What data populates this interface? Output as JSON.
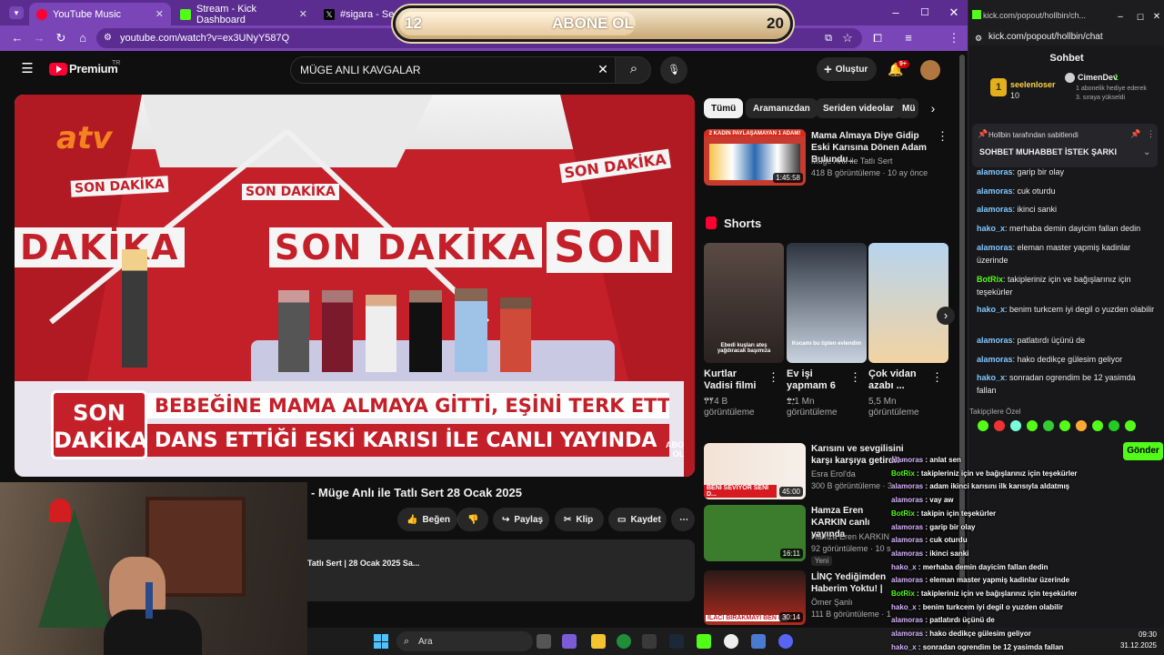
{
  "tabs": [
    {
      "title": "YouTube Music",
      "color": "#ff0033"
    },
    {
      "title": "Stream - Kick Dashboard",
      "color": "#53fc18"
    },
    {
      "title": "#sigara - Search / X",
      "color": "#000000"
    }
  ],
  "address": "youtube.com/watch?v=ex3UNyY587Q",
  "yt": {
    "logo": "Premium",
    "region": "TR",
    "search": "MÜGE ANLI KAVGALAR",
    "create": "Oluştur",
    "notif": "9+"
  },
  "video": {
    "channel_logo": "atv",
    "wall1": "SON DAKİKA",
    "wall2": "DAKİKA",
    "wall3": "SON DAKİKA",
    "wall4": "SON",
    "banner_label1": "SON",
    "banner_label2": "DAKİKA",
    "line1": "BEBEĞİNE MAMA ALMAYA GİTTİ, EŞİNİ TERK ETTİ",
    "line2": "DANS ETTİĞİ ESKİ KARISI İLE CANLI YAYINDA",
    "corner": "ABONE OL"
  },
  "video_title": "- Müge Anlı ile Tatlı Sert 28 Ocak 2025",
  "actions": {
    "like": "Beğen",
    "share": "Paylaş",
    "clip": "Klip",
    "save": "Kaydet"
  },
  "desc_snippet": "Tatlı Sert | 28 Ocak 2025 Sa...",
  "chips": [
    "Tümü",
    "Aramanızdan",
    "Seriden videolar",
    "Mü"
  ],
  "related_top": {
    "title": "Mama Almaya Diye Gidip Eski Karısına Dönen Adam Bulundu...",
    "channel": "Müge Anlı ile Tatlı Sert",
    "meta": "418 B görüntüleme · 10 ay önce",
    "duration": "1:45:58",
    "thumb_text": "2 KADIN PAYLAŞAMAYAN 1 ADAM!"
  },
  "shorts": {
    "heading": "Shorts",
    "items": [
      {
        "title": "Kurtlar Vadisi filmi ...",
        "views": "774 B görüntüleme",
        "thumb_text": "Ebedi kuşları ateş yağdıracak başımıza"
      },
      {
        "title": "Ev işi yapmam 6 ...",
        "views": "1,1 Mn görüntüleme",
        "thumb_text": "Kocamı bu tipten evlendim"
      },
      {
        "title": "Çok vidan azabı ...",
        "views": "5,5 Mn görüntüleme",
        "thumb_text": ""
      }
    ]
  },
  "related": [
    {
      "title": "Karısını ve sevgilisini karşı karşıya getirdi! - Esra...",
      "channel": "Esra Erol'da",
      "meta": "300 B görüntüleme · 3 a...",
      "duration": "45:00",
      "thumb_text": "BENİ SEVİYOR SENİ D..."
    },
    {
      "title": "Hamza Eren KARKIN canlı yayında",
      "channel": "Hamza Eren KARKIN",
      "meta": "92 görüntüleme · 10 saat önce yayınlandı",
      "duration": "16:11",
      "badge": "Yeni"
    },
    {
      "title": "LİNÇ Yediğimden Haberim Yoktu! | Ömer'le Anlar... @Okakal",
      "channel": "Ömer Şanlı",
      "meta": "111 B görüntüleme · 16 saat önce",
      "duration": "30:14",
      "badge": "Yeni",
      "thumb_text": "İLACI BIRAKMAYI BEN İS"
    }
  ],
  "kick": {
    "tab_url": "kick.com/popout/hollbin/ch...",
    "url": "kick.com/popout/hollbin/chat",
    "title": "Sohbet",
    "top1": {
      "name": "seelenloser",
      "count": "10"
    },
    "top2": {
      "name": "CimenDev",
      "count": "1",
      "desc": "1 abonelik hediye ederek 3. sıraya yükseldi"
    },
    "pinned_by": "Hollbin tarafından sabitlendi",
    "pinned_text": "SOHBET MUHABBET İSTEK ŞARKI",
    "messages": [
      {
        "user": "alamoras",
        "text": "garip bir olay",
        "bot": false
      },
      {
        "user": "alamoras",
        "text": "cuk oturdu",
        "bot": false
      },
      {
        "user": "alamoras",
        "text": "ikinci sanki",
        "bot": false
      },
      {
        "user": "hako_x",
        "text": "merhaba demin dayicim fallan dedin",
        "bot": false
      },
      {
        "user": "alamoras",
        "text": "eleman master yapmiş kadinlar üzerinde",
        "bot": false
      },
      {
        "user": "BotRix",
        "text": "takipleriniz için ve bağışlarınız için teşekürler",
        "bot": true
      },
      {
        "user": "hako_x",
        "text": "benim turkcem iyi degil o yuzden olabilir",
        "bot": false
      },
      {
        "user": "alamoras",
        "text": "patlatırdı üçünü de",
        "bot": false
      },
      {
        "user": "alamoras",
        "text": "hako dedikçe gülesim geliyor",
        "bot": false
      },
      {
        "user": "hako_x",
        "text": "sonradan ogrendim be 12 yasimda fallan",
        "bot": false
      }
    ],
    "followers_label": "Takipçilere Özel",
    "send": "Gönder",
    "send_placeholder": "Bir ... gönderin"
  },
  "overlay_chat": [
    {
      "user": "alamoras",
      "text": "anlat sen"
    },
    {
      "user": "BotRix",
      "text": "takipleriniz için ve bağışlarınız için teşekürler"
    },
    {
      "user": "alamoras",
      "text": "adam ikinci karısını ilk karısıyla aldatmış"
    },
    {
      "user": "alamoras",
      "text": "vay aw"
    },
    {
      "user": "BotRix",
      "text": "takipin için teşekürler"
    },
    {
      "user": "alamoras",
      "text": "garip bir olay"
    },
    {
      "user": "alamoras",
      "text": "cuk oturdu"
    },
    {
      "user": "alamoras",
      "text": "ikinci sanki"
    },
    {
      "user": "hako_x",
      "text": "merhaba demin dayicim fallan dedin"
    },
    {
      "user": "alamoras",
      "text": "eleman master yapmiş kadinlar üzerinde"
    },
    {
      "user": "BotRix",
      "text": "takipleriniz için ve bağışlarınız için teşekürler"
    },
    {
      "user": "hako_x",
      "text": "benim turkcem iyi degil o yuzden olabilir"
    },
    {
      "user": "alamoras",
      "text": "patlatırdı üçünü de"
    },
    {
      "user": "alamoras",
      "text": "hako dedikçe gülesim geliyor"
    },
    {
      "user": "hako_x",
      "text": "sonradan ogrendim be 12 yasimda fallan"
    }
  ],
  "abone": {
    "left": "12",
    "label": "ABONE OL",
    "right": "20",
    "progress": 0.6
  },
  "taskbar": {
    "search": "Ara",
    "time": "09:30",
    "date": "31.12.2025"
  }
}
